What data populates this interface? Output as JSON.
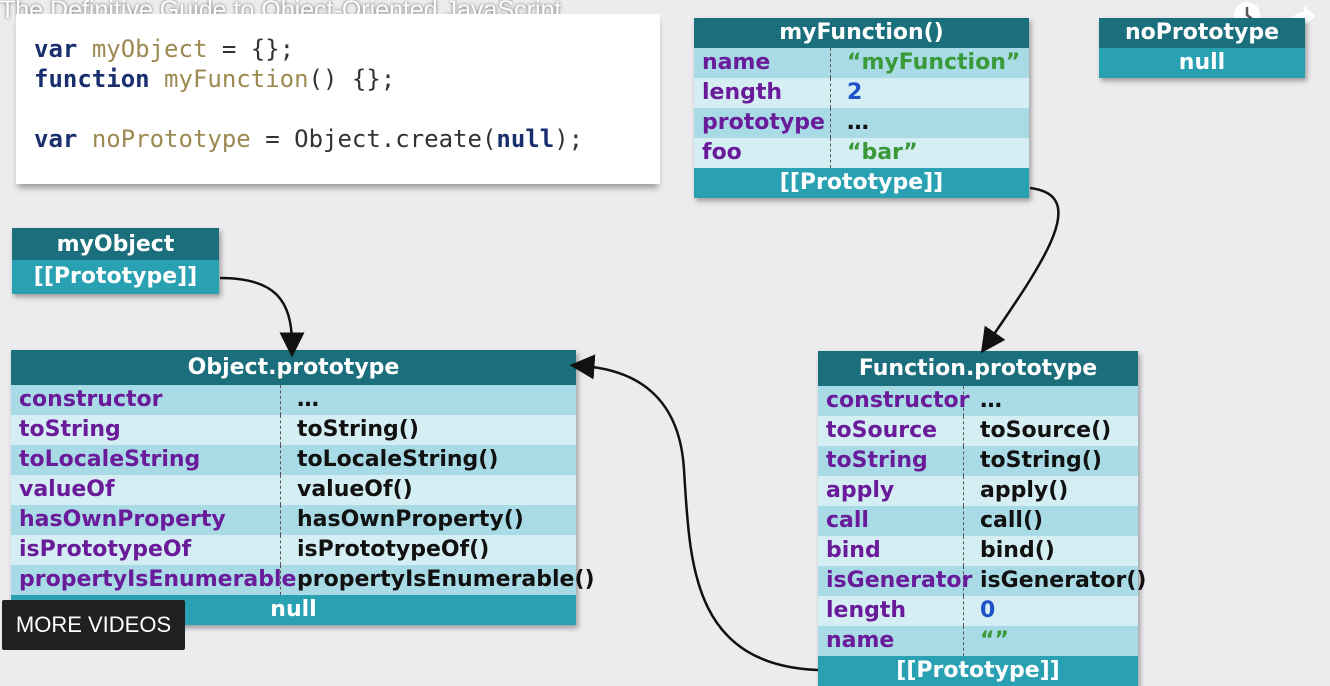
{
  "video": {
    "title": "The Definitive Guide to Object-Oriented JavaScript",
    "more_videos": "MORE VIDEOS",
    "icons": [
      "clock-icon",
      "share-icon"
    ]
  },
  "code": [
    [
      "var",
      " ",
      "myObject",
      " = {};"
    ],
    [
      "function",
      " ",
      "myFunction",
      "() {};"
    ],
    null,
    [
      "var",
      " ",
      "noPrototype",
      " = Object.create(",
      "null",
      ");"
    ]
  ],
  "myFunction": {
    "title": "myFunction()",
    "rows": [
      {
        "key": "name",
        "value": "“myFunction”"
      },
      {
        "key": "length",
        "value": "2"
      },
      {
        "key": "prototype",
        "value": "…"
      },
      {
        "key": "foo",
        "value": "“bar”"
      }
    ],
    "footer": "[[Prototype]]"
  },
  "noPrototype": {
    "title": "noPrototype",
    "value": "null"
  },
  "myObject": {
    "title": "myObject",
    "footer": "[[Prototype]]"
  },
  "objectPrototype": {
    "title": "Object.prototype",
    "rows": [
      {
        "key": "constructor",
        "value": "…"
      },
      {
        "key": "toString",
        "value": "toString()"
      },
      {
        "key": "toLocaleString",
        "value": "toLocaleString()"
      },
      {
        "key": "valueOf",
        "value": "valueOf()"
      },
      {
        "key": "hasOwnProperty",
        "value": "hasOwnProperty()"
      },
      {
        "key": "isPrototypeOf",
        "value": "isPrototypeOf()"
      },
      {
        "key": "propertyIsEnumerable",
        "value": "propertyIsEnumerable()"
      }
    ],
    "footer": "null"
  },
  "functionPrototype": {
    "title": "Function.prototype",
    "rows": [
      {
        "key": "constructor",
        "value": "…"
      },
      {
        "key": "toSource",
        "value": "toSource()"
      },
      {
        "key": "toString",
        "value": "toString()"
      },
      {
        "key": "apply",
        "value": "apply()"
      },
      {
        "key": "call",
        "value": "call()"
      },
      {
        "key": "bind",
        "value": "bind()"
      },
      {
        "key": "isGenerator",
        "value": "isGenerator()"
      },
      {
        "key": "length",
        "value": "0"
      },
      {
        "key": "name",
        "value": "“”"
      }
    ],
    "footer": "[[Prototype]]"
  },
  "colors": {
    "header": "#1b6e7b",
    "footer": "#2aa0b3",
    "rowA": "#a9dbe6",
    "rowB": "#d5eef3",
    "key": "#6a1b9a",
    "string": "#3a9a3a",
    "number": "#1e50c8"
  }
}
